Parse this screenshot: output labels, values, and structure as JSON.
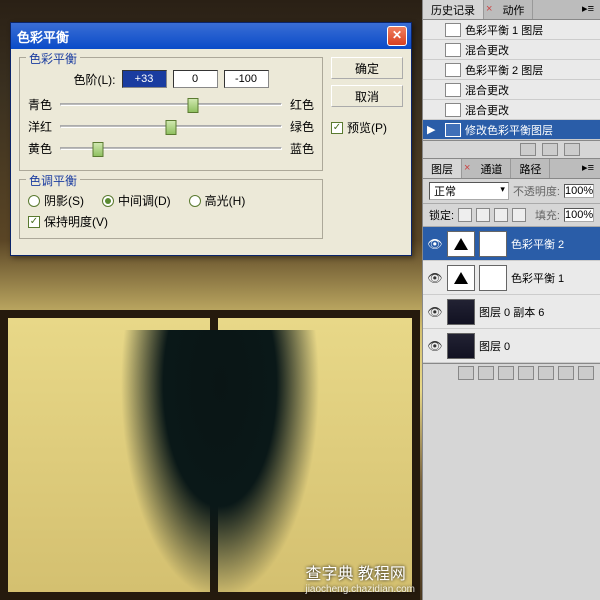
{
  "dialog": {
    "title": "色彩平衡",
    "group1_title": "色彩平衡",
    "levels_label": "色阶(L):",
    "levels": [
      "+33",
      "0",
      "-100"
    ],
    "sliders": [
      {
        "left": "青色",
        "right": "红色",
        "pos": 60
      },
      {
        "left": "洋红",
        "right": "绿色",
        "pos": 50
      },
      {
        "left": "黄色",
        "right": "蓝色",
        "pos": 17
      }
    ],
    "group2_title": "色调平衡",
    "tone": [
      {
        "label": "阴影(S)",
        "on": false
      },
      {
        "label": "中间调(D)",
        "on": true
      },
      {
        "label": "高光(H)",
        "on": false
      }
    ],
    "preserve": "保持明度(V)",
    "ok": "确定",
    "cancel": "取消",
    "preview": "预览(P)"
  },
  "history": {
    "tab1": "历史记录",
    "tab2": "动作",
    "items": [
      {
        "label": "色彩平衡 1 图层",
        "sel": false
      },
      {
        "label": "混合更改",
        "sel": false
      },
      {
        "label": "色彩平衡 2 图层",
        "sel": false
      },
      {
        "label": "混合更改",
        "sel": false
      },
      {
        "label": "混合更改",
        "sel": false
      },
      {
        "label": "修改色彩平衡图层",
        "sel": true
      }
    ]
  },
  "layers": {
    "tab1": "图层",
    "tab2": "通道",
    "tab3": "路径",
    "blend": "正常",
    "opacity_label": "不透明度:",
    "opacity": "100%",
    "lock_label": "锁定:",
    "fill_label": "填充:",
    "fill": "100%",
    "items": [
      {
        "name": "色彩平衡 2",
        "type": "adj",
        "sel": true
      },
      {
        "name": "色彩平衡 1",
        "type": "adj",
        "sel": false
      },
      {
        "name": "图层 0 副本 6",
        "type": "img",
        "sel": false
      },
      {
        "name": "图层 0",
        "type": "img",
        "sel": false
      }
    ]
  },
  "watermark": {
    "main": "查字典 教程网",
    "sub": "jiaocheng.chazidian.com"
  }
}
